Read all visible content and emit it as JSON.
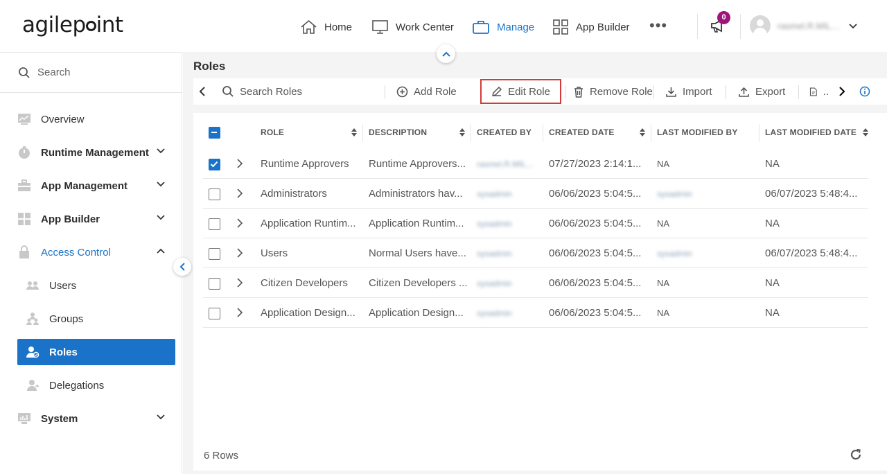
{
  "header": {
    "logo_left": "agilep",
    "logo_right": "int",
    "nav": [
      {
        "label": "Home",
        "icon": "home-icon"
      },
      {
        "label": "Work Center",
        "icon": "monitor-icon"
      },
      {
        "label": "Manage",
        "icon": "briefcase-icon",
        "active": true
      },
      {
        "label": "App Builder",
        "icon": "grid-icon"
      }
    ],
    "more": "•••",
    "notification_count": "0",
    "username": "rasmel.R.MIL…"
  },
  "sidebar": {
    "search_placeholder": "Search",
    "items": [
      {
        "label": "Overview",
        "icon": "chart-icon"
      },
      {
        "label": "Runtime Management",
        "icon": "timer-icon"
      },
      {
        "label": "App Management",
        "icon": "toolbox-icon"
      },
      {
        "label": "App Builder",
        "icon": "grid-icon"
      },
      {
        "label": "Access Control",
        "icon": "lock-icon"
      },
      {
        "label": "Users",
        "icon": "users-icon"
      },
      {
        "label": "Groups",
        "icon": "groups-icon"
      },
      {
        "label": "Roles",
        "icon": "roles-icon"
      },
      {
        "label": "Delegations",
        "icon": "delegations-icon"
      },
      {
        "label": "System",
        "icon": "system-icon"
      }
    ]
  },
  "main": {
    "title": "Roles",
    "toolbar": {
      "search_placeholder": "Search Roles",
      "add_role": "Add Role",
      "edit_role": "Edit Role",
      "remove_role": "Remove Role",
      "import": "Import",
      "export": "Export",
      "last": ".."
    },
    "columns": [
      "ROLE",
      "DESCRIPTION",
      "CREATED BY",
      "CREATED DATE",
      "LAST MODIFIED BY",
      "LAST MODIFIED DATE"
    ],
    "rows": [
      {
        "role": "Runtime Approvers",
        "description": "Runtime Approvers...",
        "created_by": "rasmel.R.MIL...",
        "created_date": "07/27/2023 2:14:1...",
        "last_modified_by": "NA",
        "last_modified_date": "NA",
        "checked": true
      },
      {
        "role": "Administrators",
        "description": "Administrators hav...",
        "created_by": "sysadmin",
        "created_date": "06/06/2023 5:04:5...",
        "last_modified_by": "sysadmin",
        "last_modified_date": "06/07/2023 5:48:4...",
        "checked": false
      },
      {
        "role": "Application Runtim...",
        "description": "Application Runtim...",
        "created_by": "sysadmin",
        "created_date": "06/06/2023 5:04:5...",
        "last_modified_by": "NA",
        "last_modified_date": "NA",
        "checked": false
      },
      {
        "role": "Users",
        "description": "Normal Users have...",
        "created_by": "sysadmin",
        "created_date": "06/06/2023 5:04:5...",
        "last_modified_by": "sysadmin",
        "last_modified_date": "06/07/2023 5:48:4...",
        "checked": false
      },
      {
        "role": "Citizen Developers",
        "description": "Citizen Developers ...",
        "created_by": "sysadmin",
        "created_date": "06/06/2023 5:04:5...",
        "last_modified_by": "NA",
        "last_modified_date": "NA",
        "checked": false
      },
      {
        "role": "Application Design...",
        "description": "Application Design...",
        "created_by": "sysadmin",
        "created_date": "06/06/2023 5:04:5...",
        "last_modified_by": "NA",
        "last_modified_date": "NA",
        "checked": false
      }
    ],
    "row_count": "6 Rows"
  },
  "colors": {
    "accent": "#1a73c8",
    "highlight": "#d33a3a",
    "badge": "#a0147a"
  }
}
